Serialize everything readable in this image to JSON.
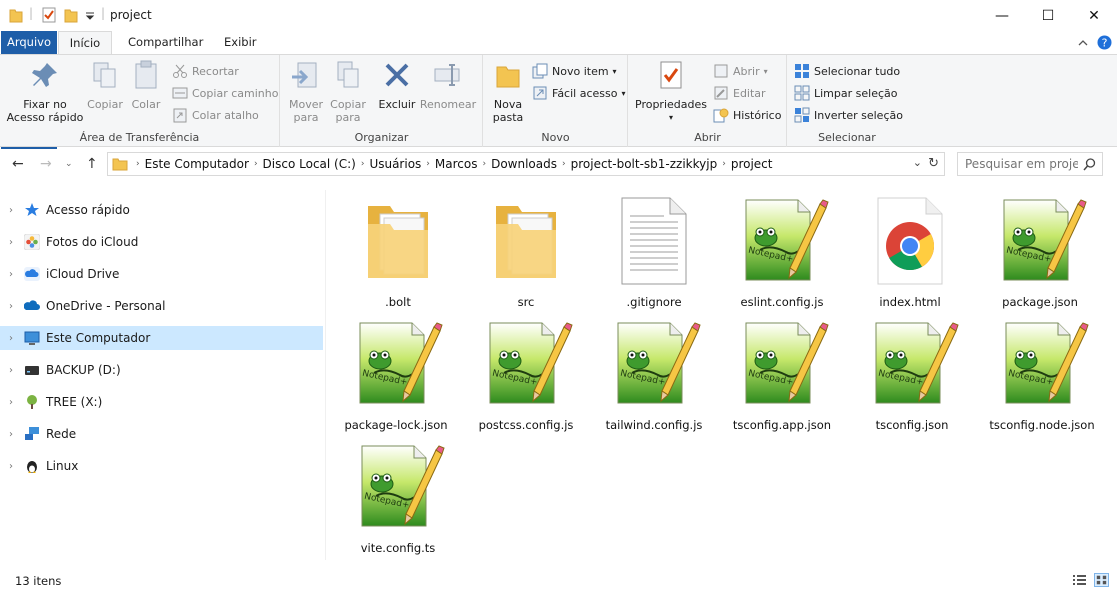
{
  "window": {
    "title": "project",
    "controls": {
      "minimize": "—",
      "maximize": "☐",
      "close": "✕"
    }
  },
  "tabs": [
    "Arquivo",
    "Início",
    "Compartilhar",
    "Exibir"
  ],
  "ribbon": {
    "clipboard": {
      "label": "Área de Transferência",
      "pin": "Fixar no\nAcesso rápido",
      "copy": "Copiar",
      "paste": "Colar",
      "cut": "Recortar",
      "copy_path": "Copiar caminho",
      "paste_shortcut": "Colar atalho"
    },
    "organize": {
      "label": "Organizar",
      "move": "Mover\npara",
      "copy_to": "Copiar\npara",
      "delete": "Excluir",
      "rename": "Renomear"
    },
    "new": {
      "label": "Novo",
      "new_folder": "Nova\npasta",
      "new_item": "Novo item",
      "easy_access": "Fácil acesso"
    },
    "open": {
      "label": "Abrir",
      "properties": "Propriedades",
      "open": "Abrir",
      "edit": "Editar",
      "history": "Histórico"
    },
    "select": {
      "label": "Selecionar",
      "select_all": "Selecionar tudo",
      "clear": "Limpar seleção",
      "invert": "Inverter seleção"
    }
  },
  "address": {
    "crumbs": [
      "Este Computador",
      "Disco Local (C:)",
      "Usuários",
      "Marcos",
      "Downloads",
      "project-bolt-sb1-zzikkyjp",
      "project"
    ],
    "search_placeholder": "Pesquisar em project"
  },
  "sidebar": {
    "items": [
      {
        "label": "Acesso rápido",
        "icon": "star-icon"
      },
      {
        "label": "Fotos do iCloud",
        "icon": "photos-icon"
      },
      {
        "label": "iCloud Drive",
        "icon": "icloud-icon"
      },
      {
        "label": "OneDrive - Personal",
        "icon": "onedrive-icon"
      },
      {
        "label": "Este Computador",
        "icon": "computer-icon"
      },
      {
        "label": "BACKUP (D:)",
        "icon": "drive-icon"
      },
      {
        "label": "TREE (X:)",
        "icon": "tree-icon"
      },
      {
        "label": "Rede",
        "icon": "network-icon"
      },
      {
        "label": "Linux",
        "icon": "linux-icon"
      }
    ]
  },
  "files": [
    {
      "name": ".bolt",
      "type": "folder"
    },
    {
      "name": "src",
      "type": "folder"
    },
    {
      "name": ".gitignore",
      "type": "text"
    },
    {
      "name": "eslint.config.js",
      "type": "notepad"
    },
    {
      "name": "index.html",
      "type": "chrome"
    },
    {
      "name": "package.json",
      "type": "notepad"
    },
    {
      "name": "package-lock.json",
      "type": "notepad"
    },
    {
      "name": "postcss.config.js",
      "type": "notepad"
    },
    {
      "name": "tailwind.config.js",
      "type": "notepad"
    },
    {
      "name": "tsconfig.app.json",
      "type": "notepad"
    },
    {
      "name": "tsconfig.json",
      "type": "notepad"
    },
    {
      "name": "tsconfig.node.json",
      "type": "notepad"
    },
    {
      "name": "vite.config.ts",
      "type": "notepad"
    }
  ],
  "status": {
    "count": "13 itens"
  },
  "colors": {
    "accent": "#1e5ea8",
    "selection": "#cce8ff",
    "folder": "#f3c451"
  }
}
